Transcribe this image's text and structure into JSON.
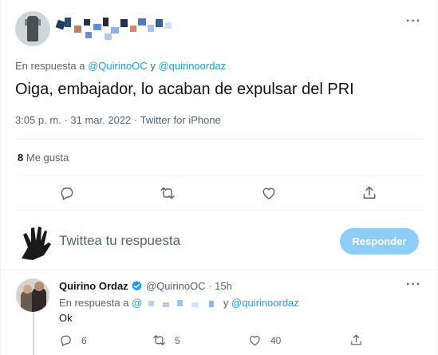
{
  "tweet": {
    "replying_prefix": "En respuesta a",
    "mention_1": "@QuirinoOC",
    "conjunction": "y",
    "mention_2": "@quirinoordaz",
    "text": "Oiga, embajador, lo acaban de expulsar del PRI",
    "time": "3:05 p. m.",
    "date": "31 mar. 2022",
    "source": "Twitter for iPhone",
    "likes_count": "8",
    "likes_label": "Me gusta",
    "more_label": "···"
  },
  "compose": {
    "placeholder": "Twittea tu respuesta",
    "reply_button": "Responder"
  },
  "reply": {
    "name": "Quirino Ordaz",
    "handle": "@QuirinoOC",
    "age": "15h",
    "replying_prefix": "En respuesta a",
    "mention_1": "@",
    "conjunction": "y",
    "mention_2": "@quirinoordaz",
    "text": "Ok",
    "replies": "6",
    "retweets": "5",
    "likes": "40",
    "more_label": "···"
  },
  "colors": {
    "accent": "#1d9bf0",
    "muted": "#536471",
    "button_disabled": "#8ecdf8"
  },
  "icons": [
    "reply-icon",
    "retweet-icon",
    "like-icon",
    "share-icon",
    "verified-badge-icon",
    "more-icon"
  ]
}
